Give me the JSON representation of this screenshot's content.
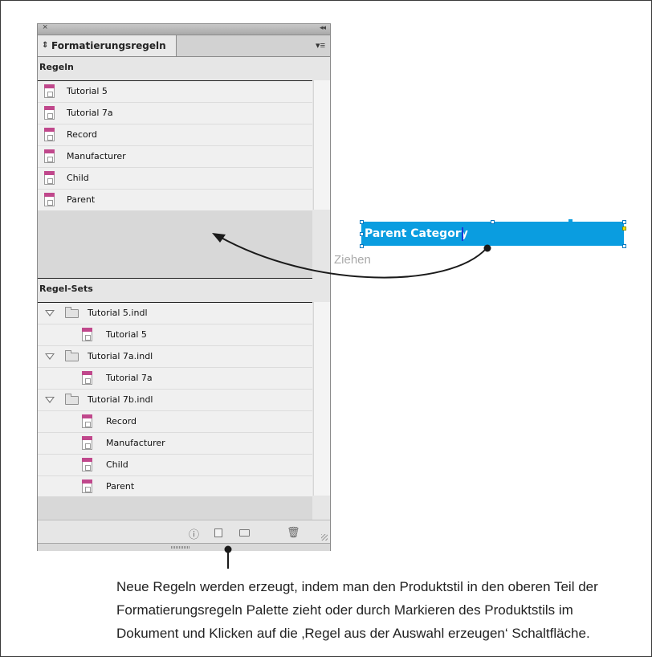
{
  "palette": {
    "tab_label": "Formatierungsregeln",
    "rules_heading": "Regeln",
    "rules": [
      "Tutorial 5",
      "Tutorial 7a",
      "Record",
      "Manufacturer",
      "Child",
      "Parent"
    ],
    "rulesets_heading": "Regel-Sets",
    "rulesets": {
      "set1": {
        "name": "Tutorial 5.indl",
        "children": [
          "Tutorial 5"
        ]
      },
      "set2": {
        "name": "Tutorial 7a.indl",
        "children": [
          "Tutorial 7a"
        ]
      },
      "set3": {
        "name": "Tutorial 7b.indl",
        "children": [
          "Record",
          "Manufacturer",
          "Child",
          "Parent"
        ]
      }
    }
  },
  "canvas": {
    "selected_text": "Parent Category",
    "drag_label": "Ziehen",
    "selection_color": "#0a9de0"
  },
  "caption": {
    "line1": "Neue Regeln werden erzeugt, indem man den Produktstil in den oberen Teil der",
    "line2": "Formatierungsregeln Palette zieht oder durch Markieren des Produktstils im",
    "line3": "Dokument und Klicken auf die ‚Regel aus der Auswahl erzeugen‘ Schaltfläche."
  },
  "icons": [
    "close-icon",
    "collapse-icon",
    "panel-menu-icon",
    "rule-icon",
    "folder-icon",
    "disclosure-triangle-icon",
    "info-icon",
    "new-rule-icon",
    "new-folder-icon",
    "trash-icon"
  ]
}
